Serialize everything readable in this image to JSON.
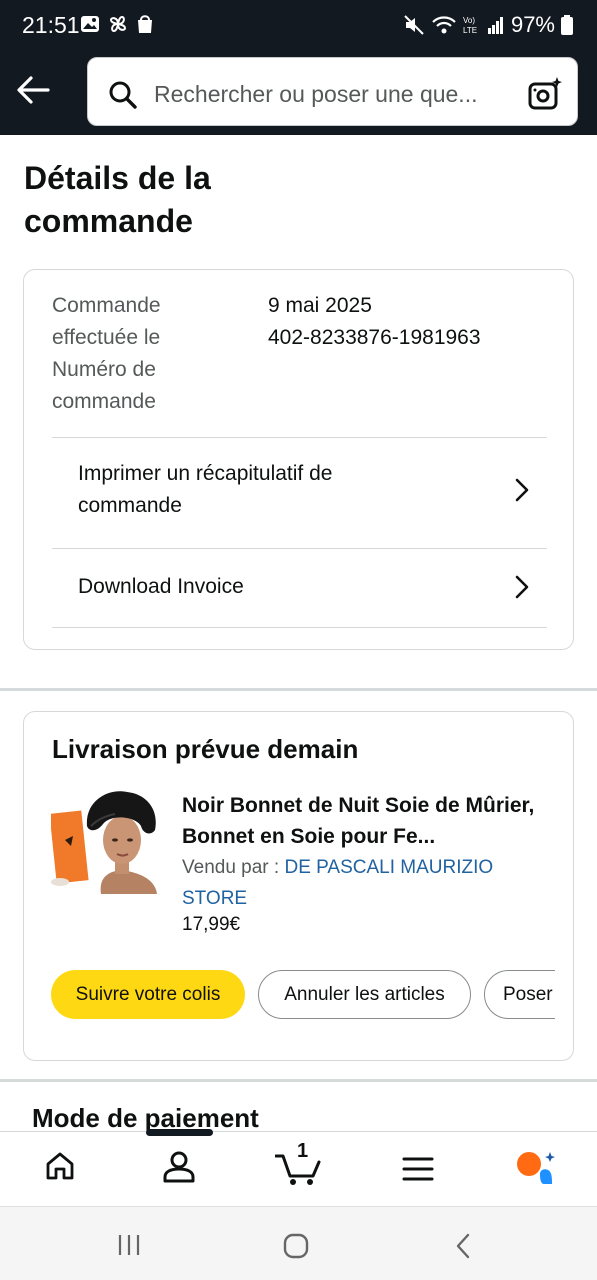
{
  "status_bar": {
    "time": "21:51",
    "battery": "97%"
  },
  "search": {
    "placeholder": "Rechercher ou poser une que..."
  },
  "page": {
    "title": "Détails de la commande"
  },
  "order": {
    "labels": "Commande effectuée le Numéro de commande",
    "date": "9 mai 2025",
    "number": "402-8233876-1981963",
    "print_link": "Imprimer un récapitulatif de commande",
    "invoice_link": "Download Invoice"
  },
  "delivery": {
    "heading": "Livraison prévue demain",
    "product_title": "Noir Bonnet de Nuit Soie de Mûrier, Bonnet en Soie pour Fe...",
    "sold_by_label": "Vendu par  :",
    "seller": "DE PASCALI MAURIZIO STORE",
    "price": "17,99€",
    "buttons": {
      "track": "Suivre votre colis",
      "cancel": "Annuler les articles",
      "ask": "Poser"
    }
  },
  "payment": {
    "heading": "Mode de paiement"
  },
  "bottom_nav": {
    "cart_count": "1",
    "items": [
      "home-icon",
      "account-icon",
      "cart-icon",
      "menu-icon",
      "rufus-icon"
    ]
  },
  "colors": {
    "header_bg": "#131921",
    "primary_button": "#ffd814",
    "link": "#2162a1"
  }
}
